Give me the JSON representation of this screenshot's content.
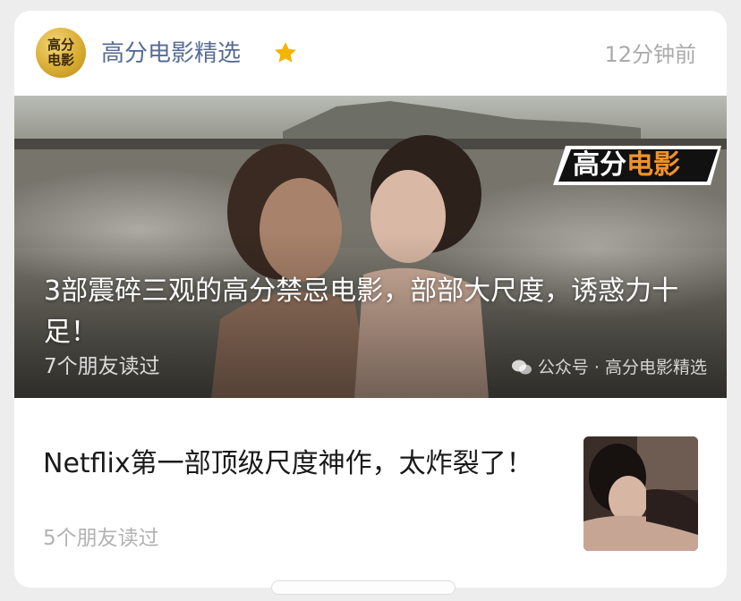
{
  "account": {
    "name": "高分电影精选",
    "avatar_text": "高分电影",
    "starred": true,
    "time": "12分钟前"
  },
  "hero_article": {
    "badge": {
      "part1": "高分",
      "part2": "电影"
    },
    "title": "3部震碎三观的高分禁忌电影，部部大尺度，诱惑力十足！",
    "reads": "7个朋友读过",
    "watermark": "公众号 · 高分电影精选"
  },
  "second_article": {
    "title": "Netflix第一部顶级尺度神作，太炸裂了！",
    "reads": "5个朋友读过"
  },
  "colors": {
    "account_name": "#576b95",
    "star": "#f5b400",
    "badge_accent": "#f0922a"
  },
  "icons": {
    "star": "star-icon",
    "wechat": "wechat-icon"
  }
}
